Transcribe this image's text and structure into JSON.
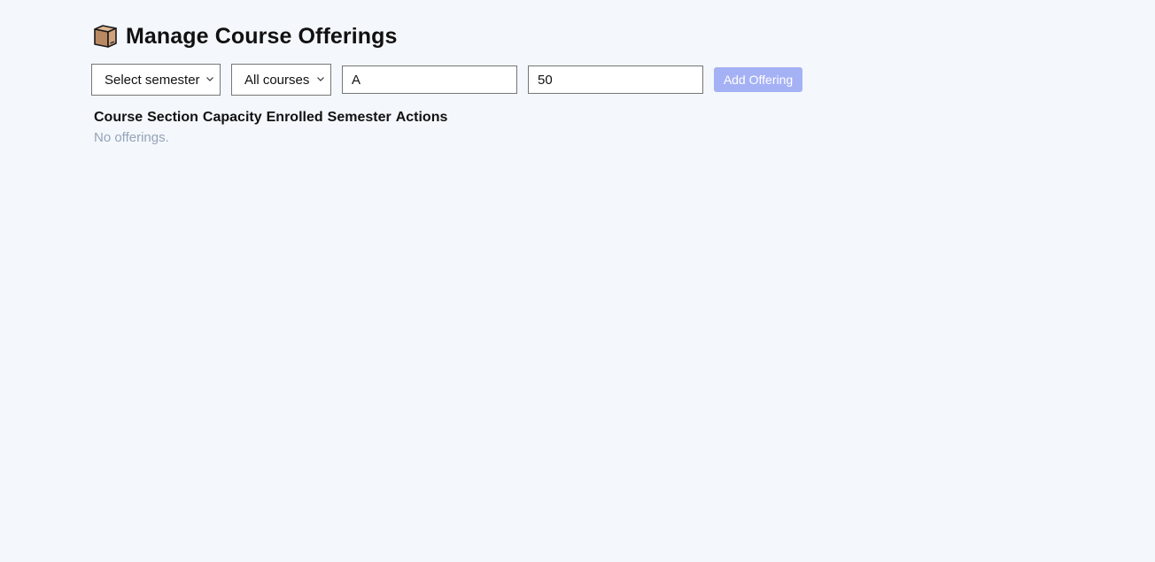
{
  "page": {
    "icon": "package-box-icon",
    "title": "Manage Course Offerings"
  },
  "toolbar": {
    "semester_select": {
      "selected": "Select semester"
    },
    "course_select": {
      "selected": "All courses"
    },
    "section_input": {
      "value": "A"
    },
    "capacity_input": {
      "value": "50"
    },
    "add_button_label": "Add Offering",
    "add_button_color": "#a5b1f5"
  },
  "table": {
    "columns": [
      "Course",
      "Section",
      "Capacity",
      "Enrolled",
      "Semester",
      "Actions"
    ],
    "empty_message": "No offerings."
  },
  "colors": {
    "background": "#f4f7fb",
    "muted_text": "#94a3b8"
  }
}
